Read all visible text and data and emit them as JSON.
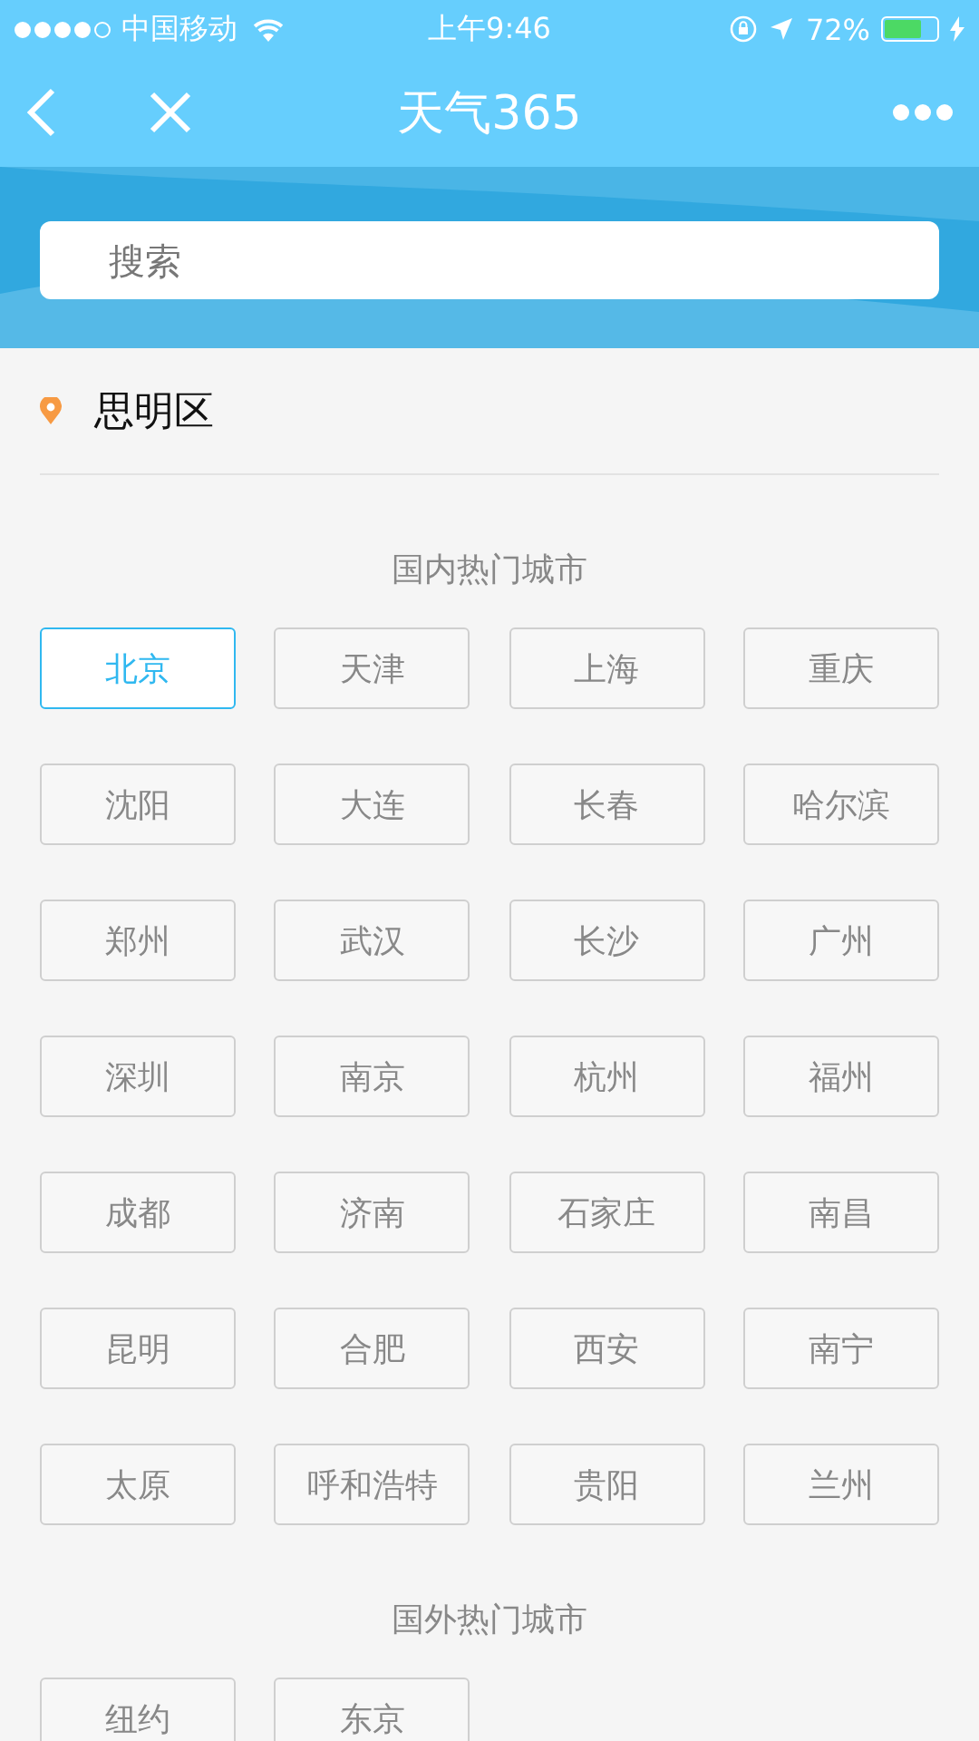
{
  "status_bar": {
    "signal_dots": [
      {
        "filled": true
      },
      {
        "filled": true
      },
      {
        "filled": true
      },
      {
        "filled": true
      },
      {
        "filled": false
      }
    ],
    "carrier": "中国移动",
    "time": "上午9:46",
    "battery_text": "72%",
    "battery": {
      "level": 0.72
    }
  },
  "nav": {
    "title": "天气365"
  },
  "search": {
    "placeholder": "搜索"
  },
  "location": {
    "name": "思明区"
  },
  "sections": [
    {
      "title": "国内热门城市",
      "cities": [
        {
          "name": "北京",
          "selected": true
        },
        {
          "name": "天津",
          "selected": false
        },
        {
          "name": "上海",
          "selected": false
        },
        {
          "name": "重庆",
          "selected": false
        },
        {
          "name": "沈阳",
          "selected": false
        },
        {
          "name": "大连",
          "selected": false
        },
        {
          "name": "长春",
          "selected": false
        },
        {
          "name": "哈尔滨",
          "selected": false
        },
        {
          "name": "郑州",
          "selected": false
        },
        {
          "name": "武汉",
          "selected": false
        },
        {
          "name": "长沙",
          "selected": false
        },
        {
          "name": "广州",
          "selected": false
        },
        {
          "name": "深圳",
          "selected": false
        },
        {
          "name": "南京",
          "selected": false
        },
        {
          "name": "杭州",
          "selected": false
        },
        {
          "name": "福州",
          "selected": false
        },
        {
          "name": "成都",
          "selected": false
        },
        {
          "name": "济南",
          "selected": false
        },
        {
          "name": "石家庄",
          "selected": false
        },
        {
          "name": "南昌",
          "selected": false
        },
        {
          "name": "昆明",
          "selected": false
        },
        {
          "name": "合肥",
          "selected": false
        },
        {
          "name": "西安",
          "selected": false
        },
        {
          "name": "南宁",
          "selected": false
        },
        {
          "name": "太原",
          "selected": false
        },
        {
          "name": "呼和浩特",
          "selected": false
        },
        {
          "name": "贵阳",
          "selected": false
        },
        {
          "name": "兰州",
          "selected": false
        }
      ]
    },
    {
      "title": "国外热门城市",
      "cities": [
        {
          "name": "纽约",
          "selected": false
        },
        {
          "name": "东京",
          "selected": false
        }
      ]
    }
  ]
}
